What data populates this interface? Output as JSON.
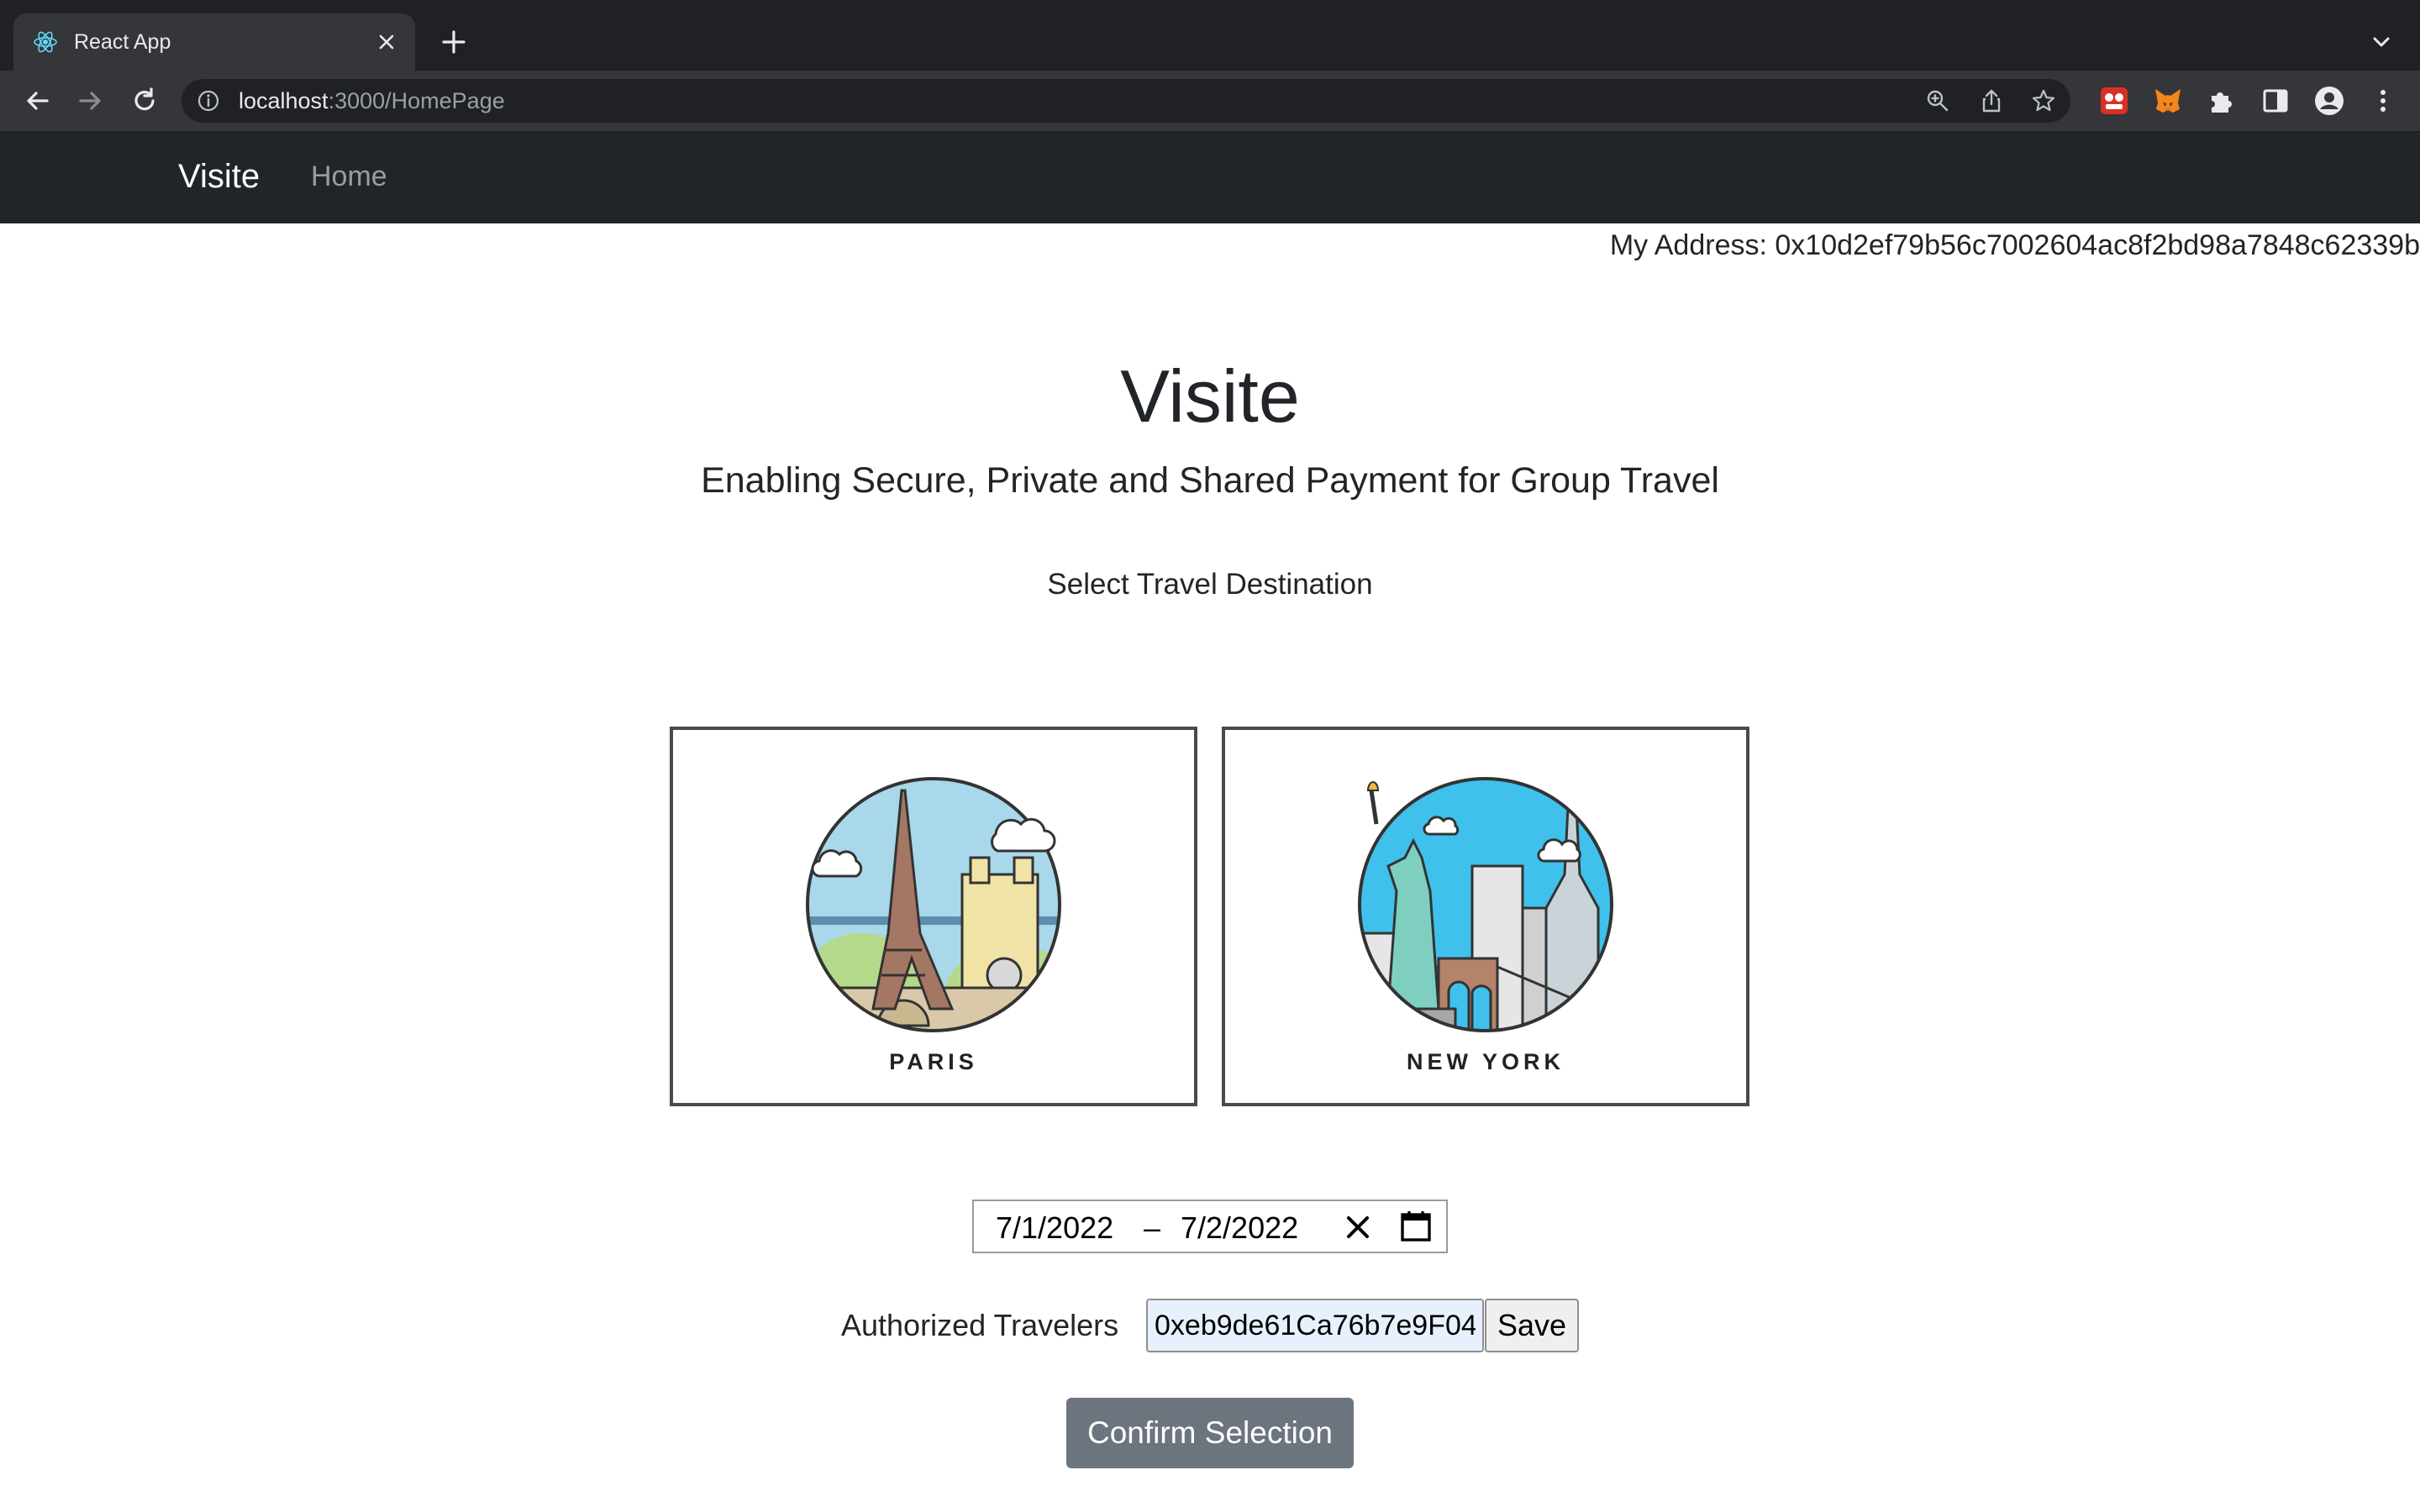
{
  "browser": {
    "tab_title": "React App",
    "url_host": "localhost",
    "url_rest": ":3000/HomePage"
  },
  "navbar": {
    "brand": "Visite",
    "home": "Home"
  },
  "account": {
    "address_label": "My Address: 0x10d2ef79b56c7002604ac8f2bd98a7848c62339b"
  },
  "hero": {
    "title": "Visite",
    "subtitle": "Enabling Secure, Private and Shared Payment for Group Travel",
    "select_label": "Select Travel Destination"
  },
  "destinations": [
    {
      "name": "PARIS"
    },
    {
      "name": "NEW YORK"
    }
  ],
  "dates": {
    "start": "7/1/2022",
    "separator": "–",
    "end": "7/2/2022"
  },
  "travelers": {
    "label": "Authorized Travelers",
    "value": "0xeb9de61Ca76b7e9F04",
    "save_label": "Save"
  },
  "confirm_label": "Confirm Selection",
  "colors": {
    "navbar_bg": "#212529",
    "confirm_bg": "#6c757d",
    "autofill_bg": "#e8f0fe"
  }
}
